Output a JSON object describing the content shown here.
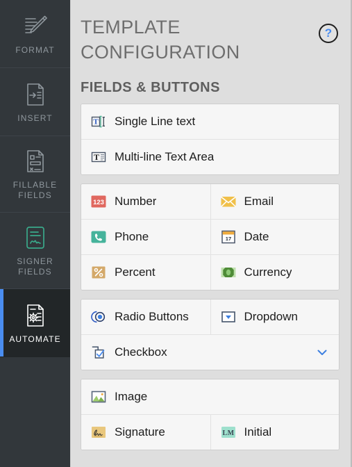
{
  "colors": {
    "rail_bg": "#32373b",
    "rail_active_bg": "#222628",
    "accent_blue": "#4a8df0",
    "panel_bg": "#dedede",
    "card_bg": "#f6f6f6",
    "number_red": "#e0685f",
    "email_yellow": "#f0c04a",
    "phone_teal": "#45b39b",
    "date_orange": "#efab3c",
    "percent_tan": "#d4a96a",
    "currency_green": "#6aa84f",
    "signature_tan": "#e9c77d",
    "initial_mint": "#9ee0cd",
    "image_green": "#8bc24a"
  },
  "rail": {
    "items": [
      {
        "label": "FORMAT",
        "icon": "format-brush-icon",
        "active": false
      },
      {
        "label": "INSERT",
        "icon": "insert-document-icon",
        "active": false
      },
      {
        "label": "FILLABLE\nFIELDS",
        "icon": "fillable-fields-icon",
        "active": false
      },
      {
        "label": "SIGNER\nFIELDS",
        "icon": "signer-fields-icon",
        "active": false
      },
      {
        "label": "AUTOMATE",
        "icon": "automate-gear-icon",
        "active": true
      }
    ]
  },
  "header": {
    "title": "TEMPLATE CONFIGURATION",
    "help_label": "?"
  },
  "main": {
    "section_title": "FIELDS & BUTTONS",
    "groups": [
      {
        "name": "text-fields-group",
        "rows": [
          {
            "cells": [
              {
                "label": "Single Line text",
                "icon": "single-line-text-icon"
              }
            ]
          },
          {
            "cells": [
              {
                "label": "Multi-line Text Area",
                "icon": "multi-line-text-icon"
              }
            ]
          }
        ]
      },
      {
        "name": "data-fields-group",
        "rows": [
          {
            "cells": [
              {
                "label": "Number",
                "icon": "number-icon"
              },
              {
                "label": "Email",
                "icon": "email-icon"
              }
            ]
          },
          {
            "cells": [
              {
                "label": "Phone",
                "icon": "phone-icon"
              },
              {
                "label": "Date",
                "icon": "date-icon"
              }
            ]
          },
          {
            "cells": [
              {
                "label": "Percent",
                "icon": "percent-icon"
              },
              {
                "label": "Currency",
                "icon": "currency-icon"
              }
            ]
          }
        ]
      },
      {
        "name": "choice-fields-group",
        "rows": [
          {
            "cells": [
              {
                "label": "Radio Buttons",
                "icon": "radio-buttons-icon"
              },
              {
                "label": "Dropdown",
                "icon": "dropdown-icon"
              }
            ]
          },
          {
            "cells": [
              {
                "label": "Checkbox",
                "icon": "checkbox-icon",
                "chevron": "chevron-down-icon"
              }
            ]
          }
        ]
      },
      {
        "name": "media-fields-group",
        "rows": [
          {
            "cells": [
              {
                "label": "Image",
                "icon": "image-icon"
              }
            ]
          },
          {
            "cells": [
              {
                "label": "Signature",
                "icon": "signature-icon"
              },
              {
                "label": "Initial",
                "icon": "initial-icon"
              }
            ]
          }
        ]
      }
    ]
  }
}
